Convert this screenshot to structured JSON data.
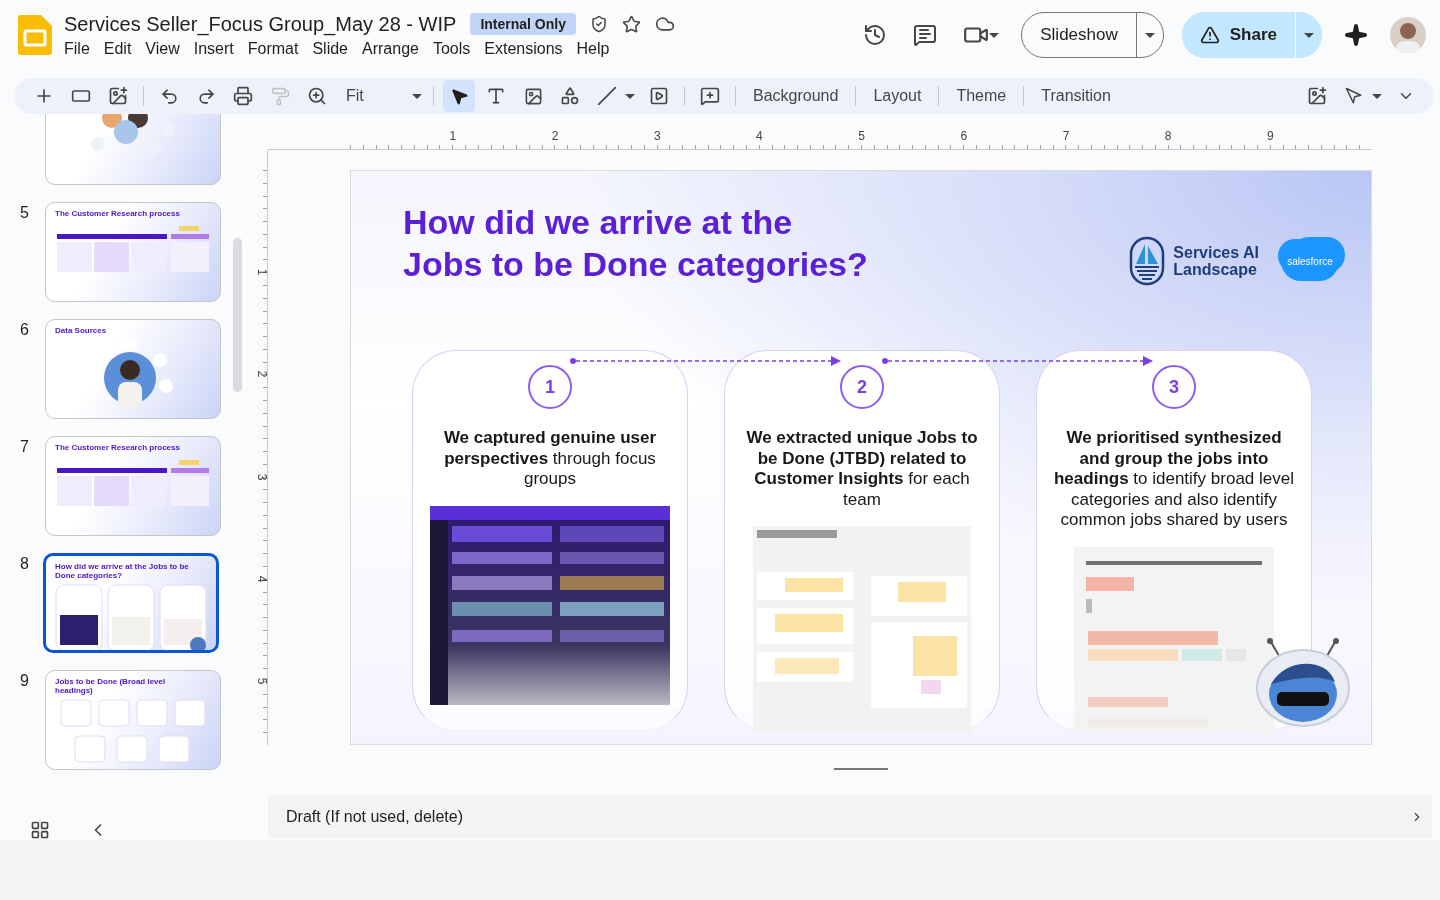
{
  "document": {
    "title": "Services Seller_Focus Group_May 28 - WIP",
    "badge": "Internal Only"
  },
  "menu": [
    "File",
    "Edit",
    "View",
    "Insert",
    "Format",
    "Slide",
    "Arrange",
    "Tools",
    "Extensions",
    "Help"
  ],
  "header_buttons": {
    "slideshow": "Slideshow",
    "share": "Share"
  },
  "toolbar": {
    "pointer_selected": true,
    "paint_format_disabled": true,
    "zoom": "Fit",
    "text_buttons": [
      "Background",
      "Layout",
      "Theme",
      "Transition"
    ]
  },
  "slides": [
    {
      "kind": "diagram",
      "selected": false
    },
    {
      "number": "5",
      "kind": "process",
      "title": "The Customer Research process",
      "selected": false
    },
    {
      "number": "6",
      "kind": "sources",
      "title": "Data Sources",
      "selected": false
    },
    {
      "number": "7",
      "kind": "process",
      "title": "The Customer Research process",
      "selected": false
    },
    {
      "number": "8",
      "kind": "steps",
      "title": "How did we arrive at the Jobs to be Done categories?",
      "selected": true
    },
    {
      "number": "9",
      "kind": "headings",
      "title": "Jobs to be Done (Broad level headings)",
      "selected": false
    }
  ],
  "rulers": {
    "horizontal": [
      "1",
      "2",
      "3",
      "4",
      "5",
      "6",
      "7",
      "8",
      "9"
    ],
    "vertical": [
      "1",
      "2",
      "3",
      "4",
      "5"
    ]
  },
  "slide": {
    "title_lines": [
      "How did we arrive at the",
      "Jobs to be Done categories?"
    ],
    "logo_lines": [
      "Services AI",
      "Landscape"
    ],
    "brand": "salesforce",
    "steps": [
      {
        "number": "1",
        "text": "**We captured genuine user perspectives** through focus groups"
      },
      {
        "number": "2",
        "text": "**We extracted unique Jobs to be Done (JTBD) related to Customer Insights** for each team"
      },
      {
        "number": "3",
        "text": "**We prioritised synthesized and group the jobs into headings** to identify broad level categories and also identify common jobs shared by users"
      }
    ]
  },
  "notes": "Draft (If not used, delete)"
}
